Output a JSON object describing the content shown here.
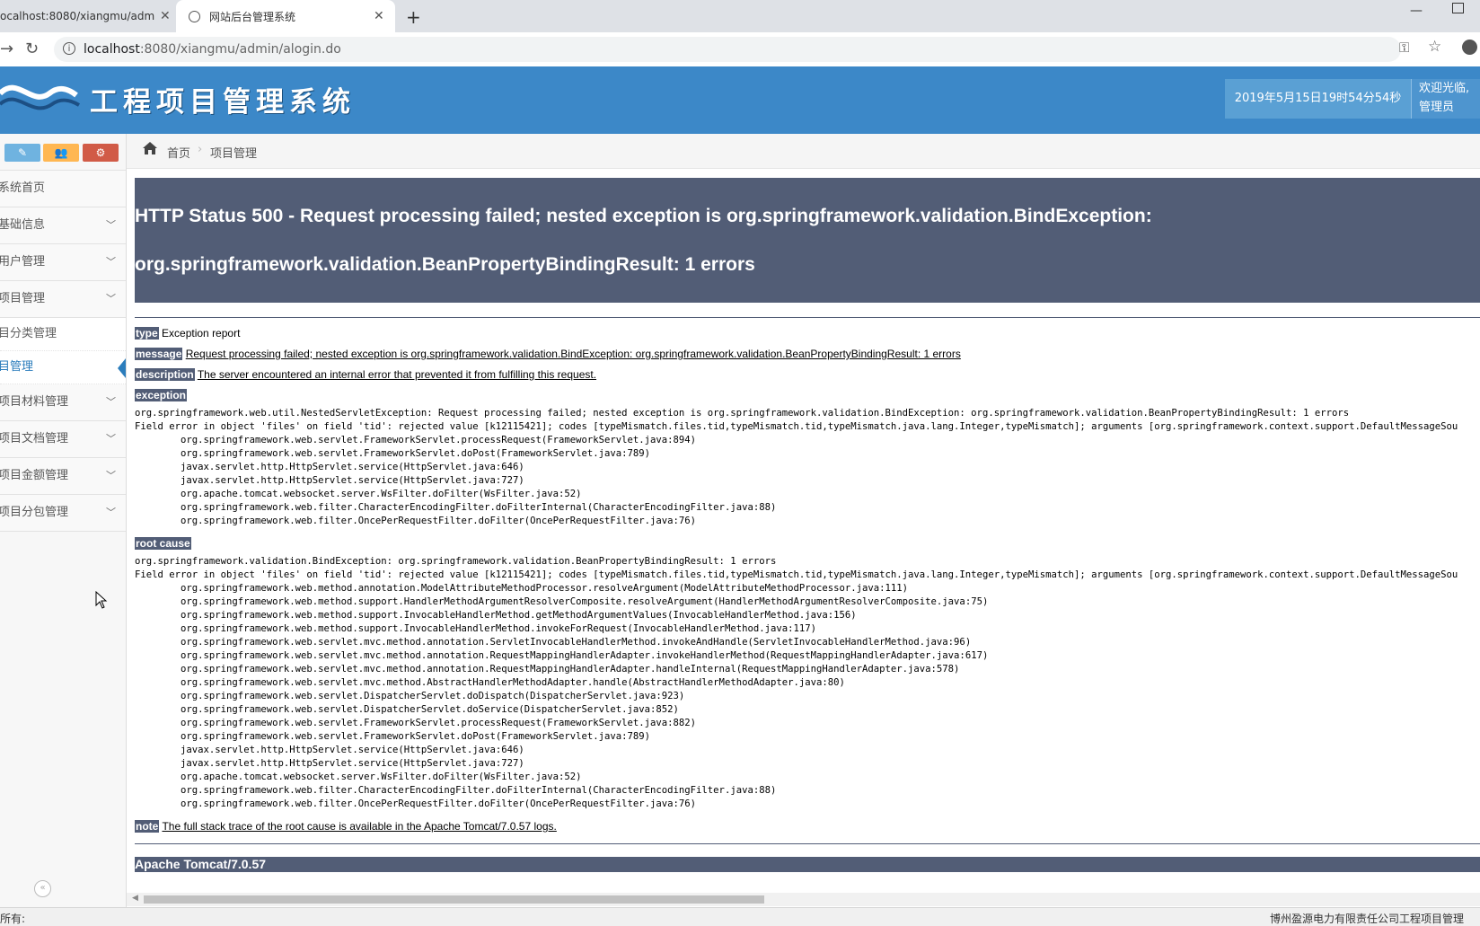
{
  "browser": {
    "tabs": [
      {
        "title": "ocalhost:8080/xiangmu/adm"
      },
      {
        "title": "网站后台管理系统"
      }
    ],
    "close_glyph": "✕",
    "new_tab_glyph": "+",
    "minimize_glyph": "—",
    "url_host": "localhost",
    "url_rest": ":8080/xiangmu/admin/alogin.do",
    "icons": [
      "back-arrow-icon",
      "reload-icon",
      "info-icon",
      "key-icon",
      "star-icon",
      "account-icon"
    ]
  },
  "header": {
    "title": "工程项目管理系统",
    "datetime": "2019年5月15日19时54分54秒",
    "welcome_line1": "欢迎光临,",
    "welcome_line2": "管理员",
    "colors": {
      "bar": "#3c88c8",
      "datetime_bg": "#5aa0d4"
    }
  },
  "sidebar": {
    "buttons": [
      {
        "icon": "pencil-icon",
        "glyph": "✎",
        "color": "#6fb3e0"
      },
      {
        "icon": "group-icon",
        "glyph": "👥",
        "color": "#ffb752"
      },
      {
        "icon": "cogs-icon",
        "glyph": "⚙",
        "color": "#d15b47"
      }
    ],
    "items": [
      {
        "label": "系统首页",
        "chevron": ""
      },
      {
        "label": "基础信息",
        "chevron": "﹀"
      },
      {
        "label": "用户管理",
        "chevron": "﹀"
      },
      {
        "label": "项目管理",
        "chevron": "﹀"
      }
    ],
    "subitems": [
      {
        "label": "目分类管理"
      },
      {
        "label": "目管理"
      }
    ],
    "items2": [
      {
        "label": "项目材料管理",
        "chevron": "﹀"
      },
      {
        "label": "项目文档管理",
        "chevron": "﹀"
      },
      {
        "label": "项目金额管理",
        "chevron": "﹀"
      },
      {
        "label": "项目分包管理",
        "chevron": "﹀"
      }
    ],
    "collapse_glyph": "«"
  },
  "breadcrumb": {
    "home": "首页",
    "separator": "›",
    "current": "项目管理"
  },
  "error": {
    "title_line1": "HTTP Status 500 - Request processing failed; nested exception is org.springframework.validation.BindException:",
    "title_line2": "org.springframework.validation.BeanPropertyBindingResult: 1 errors",
    "type_label": "type",
    "type_value": "Exception report",
    "message_label": "message",
    "message_value": "Request processing failed; nested exception is org.springframework.validation.BindException: org.springframework.validation.BeanPropertyBindingResult: 1 errors",
    "description_label": "description",
    "description_value": "The server encountered an internal error that prevented it from fulfilling this request.",
    "exception_label": "exception",
    "exception_trace": "org.springframework.web.util.NestedServletException: Request processing failed; nested exception is org.springframework.validation.BindException: org.springframework.validation.BeanPropertyBindingResult: 1 errors\nField error in object 'files' on field 'tid': rejected value [k12115421]; codes [typeMismatch.files.tid,typeMismatch.tid,typeMismatch.java.lang.Integer,typeMismatch]; arguments [org.springframework.context.support.DefaultMessageSou\n\torg.springframework.web.servlet.FrameworkServlet.processRequest(FrameworkServlet.java:894)\n\torg.springframework.web.servlet.FrameworkServlet.doPost(FrameworkServlet.java:789)\n\tjavax.servlet.http.HttpServlet.service(HttpServlet.java:646)\n\tjavax.servlet.http.HttpServlet.service(HttpServlet.java:727)\n\torg.apache.tomcat.websocket.server.WsFilter.doFilter(WsFilter.java:52)\n\torg.springframework.web.filter.CharacterEncodingFilter.doFilterInternal(CharacterEncodingFilter.java:88)\n\torg.springframework.web.filter.OncePerRequestFilter.doFilter(OncePerRequestFilter.java:76)",
    "root_cause_label": "root cause",
    "root_cause_trace": "org.springframework.validation.BindException: org.springframework.validation.BeanPropertyBindingResult: 1 errors\nField error in object 'files' on field 'tid': rejected value [k12115421]; codes [typeMismatch.files.tid,typeMismatch.tid,typeMismatch.java.lang.Integer,typeMismatch]; arguments [org.springframework.context.support.DefaultMessageSou\n\torg.springframework.web.method.annotation.ModelAttributeMethodProcessor.resolveArgument(ModelAttributeMethodProcessor.java:111)\n\torg.springframework.web.method.support.HandlerMethodArgumentResolverComposite.resolveArgument(HandlerMethodArgumentResolverComposite.java:75)\n\torg.springframework.web.method.support.InvocableHandlerMethod.getMethodArgumentValues(InvocableHandlerMethod.java:156)\n\torg.springframework.web.method.support.InvocableHandlerMethod.invokeForRequest(InvocableHandlerMethod.java:117)\n\torg.springframework.web.servlet.mvc.method.annotation.ServletInvocableHandlerMethod.invokeAndHandle(ServletInvocableHandlerMethod.java:96)\n\torg.springframework.web.servlet.mvc.method.annotation.RequestMappingHandlerAdapter.invokeHandlerMethod(RequestMappingHandlerAdapter.java:617)\n\torg.springframework.web.servlet.mvc.method.annotation.RequestMappingHandlerAdapter.handleInternal(RequestMappingHandlerAdapter.java:578)\n\torg.springframework.web.servlet.mvc.method.AbstractHandlerMethodAdapter.handle(AbstractHandlerMethodAdapter.java:80)\n\torg.springframework.web.servlet.DispatcherServlet.doDispatch(DispatcherServlet.java:923)\n\torg.springframework.web.servlet.DispatcherServlet.doService(DispatcherServlet.java:852)\n\torg.springframework.web.servlet.FrameworkServlet.processRequest(FrameworkServlet.java:882)\n\torg.springframework.web.servlet.FrameworkServlet.doPost(FrameworkServlet.java:789)\n\tjavax.servlet.http.HttpServlet.service(HttpServlet.java:646)\n\tjavax.servlet.http.HttpServlet.service(HttpServlet.java:727)\n\torg.apache.tomcat.websocket.server.WsFilter.doFilter(WsFilter.java:52)\n\torg.springframework.web.filter.CharacterEncodingFilter.doFilterInternal(CharacterEncodingFilter.java:88)\n\torg.springframework.web.filter.OncePerRequestFilter.doFilter(OncePerRequestFilter.java:76)",
    "note_label": "note",
    "note_value": "The full stack trace of the root cause is available in the Apache Tomcat/7.0.57 logs.",
    "server": "Apache Tomcat/7.0.57",
    "colors": {
      "label_bg": "#525d76"
    }
  },
  "statusbar": {
    "left": "所有:",
    "right": "博州盈源电力有限责任公司工程项目管理"
  }
}
